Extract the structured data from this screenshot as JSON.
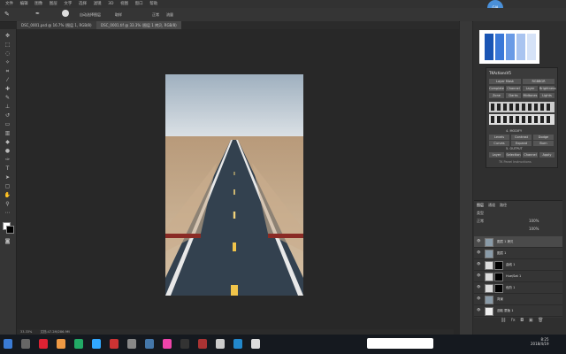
{
  "menubar": {
    "items": [
      "文件",
      "编辑",
      "图像",
      "图层",
      "文字",
      "选择",
      "滤镜",
      "3D",
      "视图",
      "窗口",
      "帮助"
    ]
  },
  "options": {
    "auto_select": "自动选择图层",
    "sample": "取样",
    "mode_label": "正常",
    "flow": "流量"
  },
  "tabs": [
    {
      "label": "DSC_0001.psd @ 16.7% (图层 1, RGB/8)"
    },
    {
      "label": "DSC_0001.tif @ 33.3% (图层 1 拷贝, RGB/8)"
    }
  ],
  "status": {
    "zoom": "33.33%",
    "doc": "文档:47.2M/286.9M"
  },
  "avatar": {
    "label": "GIA"
  },
  "plugin": {
    "title": "TKActionsV5",
    "row1": [
      "Layer Mask",
      "RGBBGR"
    ],
    "row2": [
      "Complete",
      "Channel",
      "Layer",
      "Brightness"
    ],
    "tabs": [
      "Zone",
      "Darks",
      "Midtones",
      "Lights"
    ],
    "sections": [
      "4. MODIFY",
      "5. OUTPUT"
    ],
    "modify": [
      "Levels",
      "Curves",
      "Contrast",
      "Expand",
      "Dodge",
      "Burn"
    ],
    "output": [
      "Layer",
      "Selection",
      "Channel",
      "Apply"
    ],
    "footer": "TK Panel Instructions"
  },
  "layers": {
    "tabs": [
      "图层",
      "通道",
      "路径"
    ],
    "kind": "类型",
    "blend": "正常",
    "opacity": "100%",
    "fill": "100%",
    "rows": [
      {
        "name": "图层 1 拷贝"
      },
      {
        "name": "图层 1"
      },
      {
        "name": "曲线 1"
      },
      {
        "name": "Hue/Sat 1"
      },
      {
        "name": "色阶 1"
      },
      {
        "name": "背景"
      },
      {
        "name": "选取 蒙版 1"
      }
    ]
  },
  "taskbar": {
    "time": "8:25",
    "date": "2018/4/19"
  },
  "colors": {
    "accent": "#4a90d9",
    "panel": "#353535",
    "canvas": "#282828"
  }
}
